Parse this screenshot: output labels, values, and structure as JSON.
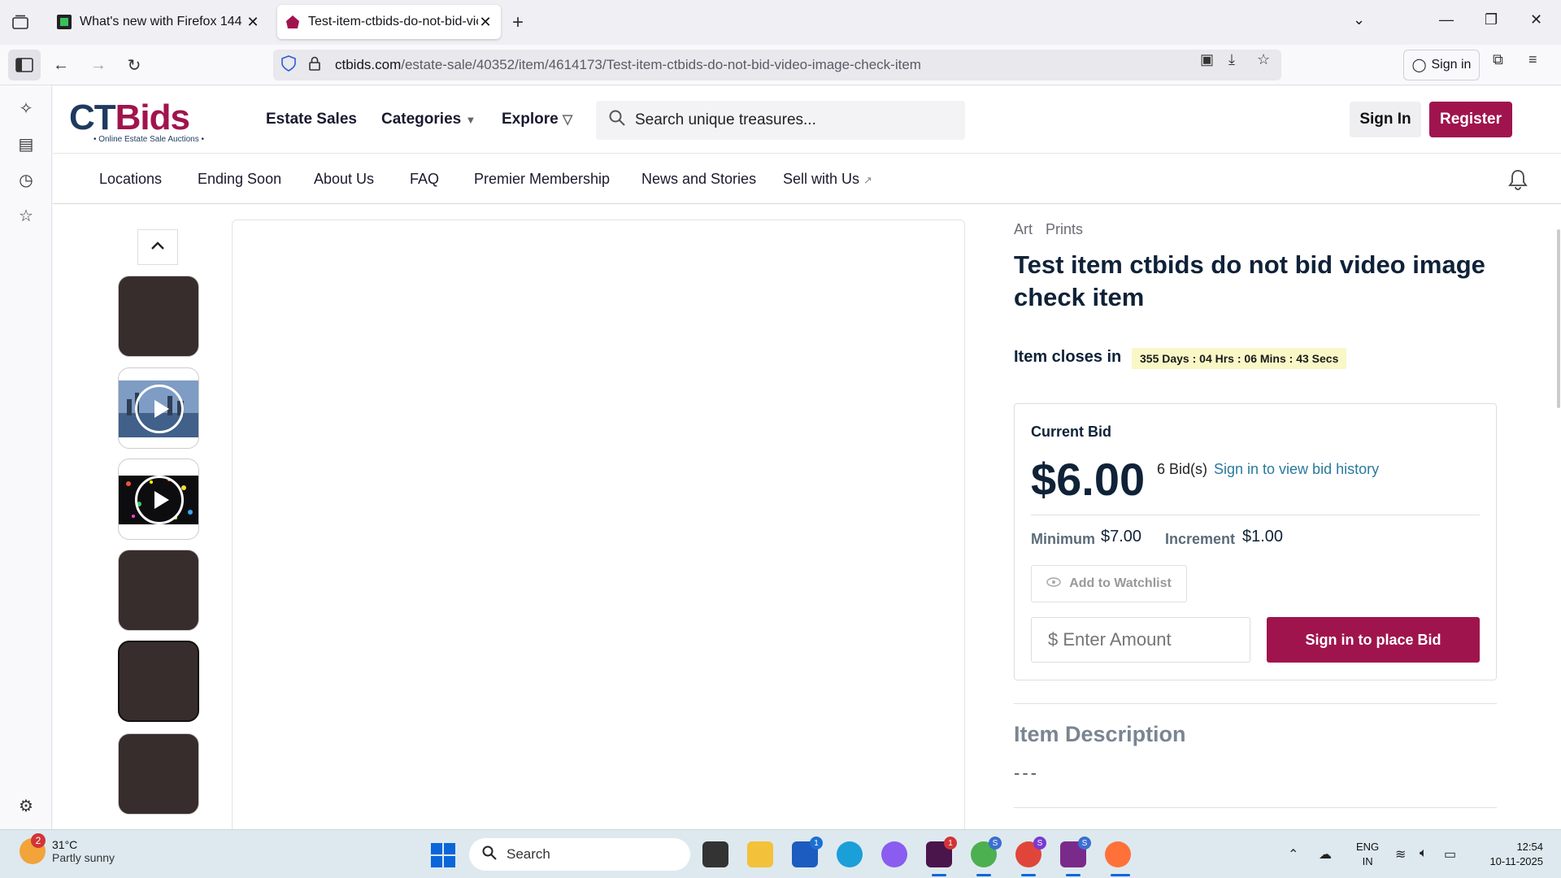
{
  "browser": {
    "tabs": [
      {
        "label": "What's new with Firefox 144",
        "active": false
      },
      {
        "label": "Test-item-ctbids-do-not-bid-vic",
        "active": true
      }
    ],
    "url_host": "ctbids.com",
    "url_path": "/estate-sale/40352/item/4614173/Test-item-ctbids-do-not-bid-video-image-check-item",
    "signin_label": "Sign in"
  },
  "site": {
    "logo_text_a": "CT",
    "logo_text_b": "Bids",
    "logo_tagline": "• Online Estate Sale Auctions •",
    "nav": {
      "estate_sales": "Estate Sales",
      "categories": "Categories",
      "explore": "Explore"
    },
    "search_placeholder": "Search unique treasures...",
    "signin": "Sign In",
    "register": "Register",
    "subnav": [
      "Locations",
      "Ending Soon",
      "About Us",
      "FAQ",
      "Premier Membership",
      "News and Stories",
      "Sell with Us"
    ]
  },
  "item": {
    "breadcrumb": [
      "Art",
      "Prints"
    ],
    "title": "Test item ctbids do not bid video image check item",
    "closes_label": "Item closes in",
    "countdown": "355 Days : 04 Hrs : 06 Mins : 43 Secs",
    "current_bid_label": "Current Bid",
    "current_bid": "$6.00",
    "bid_count": "6 Bid(s)",
    "bid_history_link": "Sign in to view bid history",
    "minimum_label": "Minimum",
    "minimum_value": "$7.00",
    "increment_label": "Increment",
    "increment_value": "$1.00",
    "watchlist": "Add to Watchlist",
    "amount_placeholder": "$ Enter Amount",
    "place_bid": "Sign in to place Bid",
    "description_title": "Item Description",
    "description_body": "---"
  },
  "taskbar": {
    "temperature": "31°C",
    "weather": "Partly sunny",
    "weather_badge": "2",
    "search": "Search",
    "lang_1": "ENG",
    "lang_2": "IN",
    "time": "12:54",
    "date": "10-11-2025"
  },
  "colors": {
    "brand_primary": "#a0144e",
    "brand_navy": "#1e3a5f",
    "link": "#2a7a9e"
  }
}
